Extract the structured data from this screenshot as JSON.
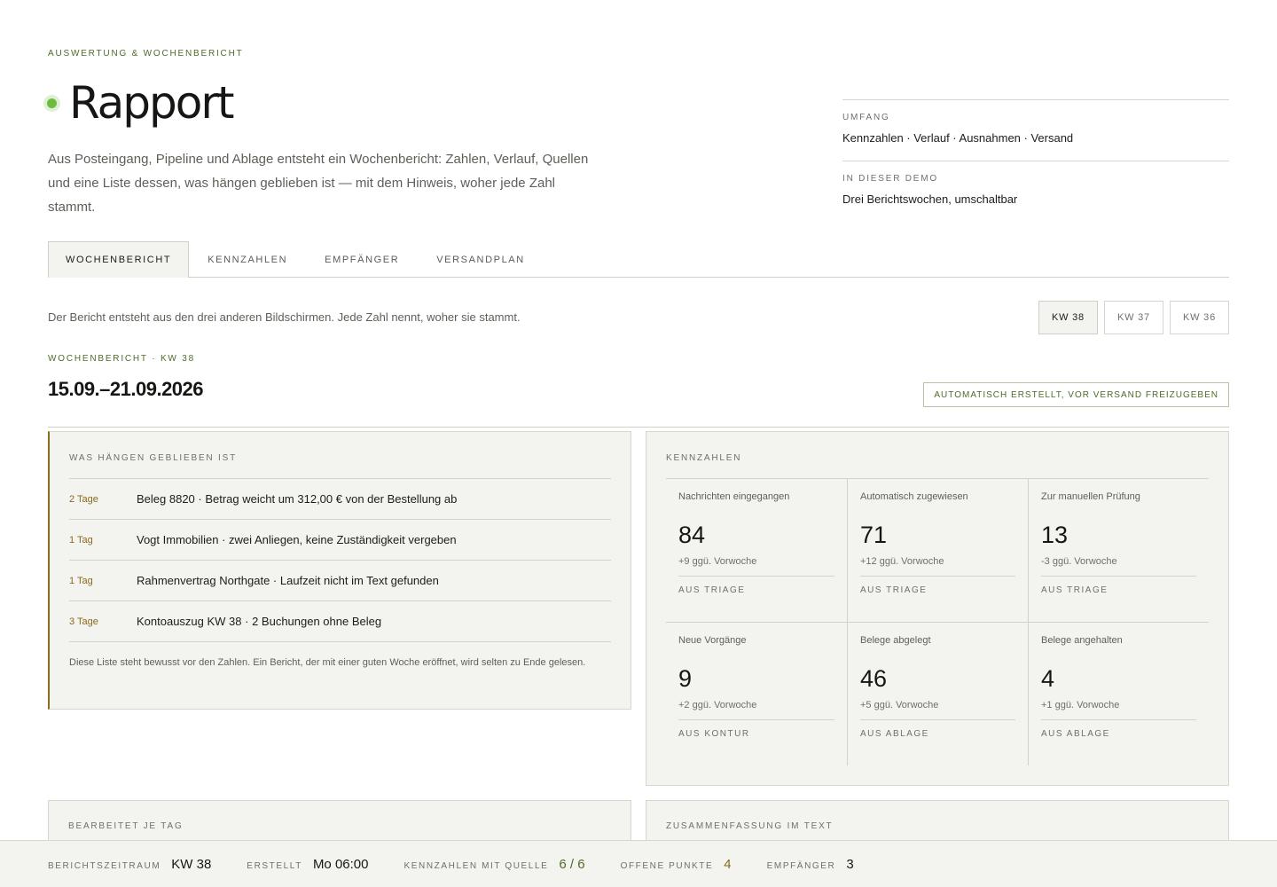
{
  "header": {
    "kicker": "AUSWERTUNG & WOCHENBERICHT",
    "title": "Rapport",
    "lead": "Aus Posteingang, Pipeline und Ablage entsteht ein Wochenbericht: Zahlen, Verlauf, Quellen und eine Liste dessen, was hängen geblieben ist — mit dem Hinweis, woher jede Zahl stammt."
  },
  "meta": [
    {
      "label": "UMFANG",
      "value": "Kennzahlen · Verlauf · Ausnahmen · Versand"
    },
    {
      "label": "IN DIESER DEMO",
      "value": "Drei Berichtswochen, umschaltbar"
    }
  ],
  "tabs": [
    "WOCHENBERICHT",
    "KENNZAHLEN",
    "EMPFÄNGER",
    "VERSANDPLAN"
  ],
  "active_tab": "WOCHENBERICHT",
  "intro": "Der Bericht entsteht aus den drei anderen Bildschirmen. Jede Zahl nennt, woher sie stammt.",
  "weeks": [
    "KW 38",
    "KW 37",
    "KW 36"
  ],
  "active_week": "KW 38",
  "report": {
    "kicker": "WOCHENBERICHT · KW 38",
    "range": "15.09.–21.09.2026",
    "badge": "AUTOMATISCH ERSTELLT, VOR VERSAND FREIZUGEBEN"
  },
  "stuck": {
    "title": "WAS HÄNGEN GEBLIEBEN IST",
    "items": [
      {
        "age": "2 Tage",
        "text": "Beleg 8820 · Betrag weicht um 312,00 € von der Bestellung ab"
      },
      {
        "age": "1 Tag",
        "text": "Vogt Immobilien · zwei Anliegen, keine Zuständigkeit vergeben"
      },
      {
        "age": "1 Tag",
        "text": "Rahmenvertrag Northgate · Laufzeit nicht im Text gefunden"
      },
      {
        "age": "3 Tage",
        "text": "Kontoauszug KW 38 · 2 Buchungen ohne Beleg"
      }
    ],
    "note": "Diese Liste steht bewusst vor den Zahlen. Ein Bericht, der mit einer guten Woche eröffnet, wird selten zu Ende gelesen."
  },
  "kpis": {
    "title": "KENNZAHLEN",
    "items": [
      {
        "label": "Nachrichten eingegangen",
        "value": "84",
        "delta": "+9 ggü. Vorwoche",
        "source": "AUS TRIAGE"
      },
      {
        "label": "Automatisch zugewiesen",
        "value": "71",
        "delta": "+12 ggü. Vorwoche",
        "source": "AUS TRIAGE"
      },
      {
        "label": "Zur manuellen Prüfung",
        "value": "13",
        "delta": "-3 ggü. Vorwoche",
        "source": "AUS TRIAGE"
      },
      {
        "label": "Neue Vorgänge",
        "value": "9",
        "delta": "+2 ggü. Vorwoche",
        "source": "AUS KONTUR"
      },
      {
        "label": "Belege abgelegt",
        "value": "46",
        "delta": "+5 ggü. Vorwoche",
        "source": "AUS ABLAGE"
      },
      {
        "label": "Belege angehalten",
        "value": "4",
        "delta": "+1 ggü. Vorwoche",
        "source": "AUS ABLAGE"
      }
    ]
  },
  "daily": {
    "title": "BEARBEITET JE TAG"
  },
  "summary": {
    "title": "ZUSAMMENFASSUNG IM TEXT"
  },
  "statusbar": {
    "period_label": "BERICHTSZEITRAUM",
    "period_value": "KW 38",
    "created_label": "ERSTELLT",
    "created_value": "Mo 06:00",
    "sourced_label": "KENNZAHLEN MIT QUELLE",
    "sourced_value": "6 / 6",
    "open_label": "OFFENE PUNKTE",
    "open_value": "4",
    "recipients_label": "EMPFÄNGER",
    "recipients_value": "3"
  },
  "colors": {
    "accent_green": "#4e6b2a",
    "status_dot": "#6dbb3f",
    "warning_amber": "#8a6a1d",
    "panel_bg": "#f3f4ef"
  }
}
